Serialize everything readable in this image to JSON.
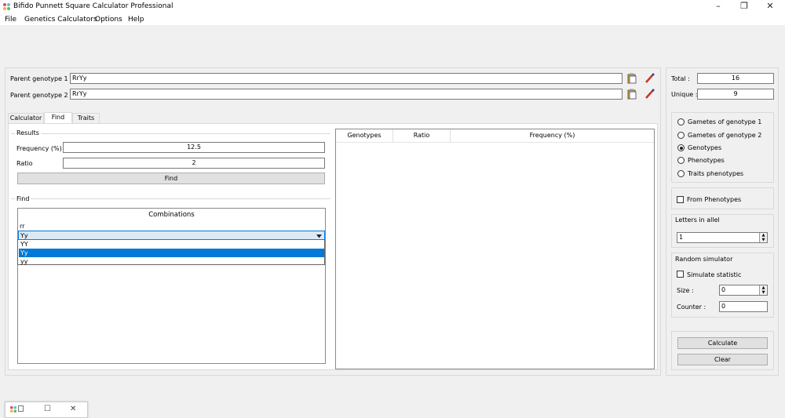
{
  "window": {
    "title": "Bifido Punnett Square Calculator Professional",
    "minimize": "–",
    "restore": "❐",
    "close": "✕"
  },
  "menu": [
    "File",
    "Genetics Calculators",
    "Options",
    "Help"
  ],
  "parents": {
    "p1_label": "Parent genotype 1 :",
    "p1_value": "RrYy",
    "p2_label": "Parent genotype 2 :",
    "p2_value": "RrYy"
  },
  "stats": {
    "total_label": "Total :",
    "total_value": "16",
    "unique_label": "Unique :",
    "unique_value": "9"
  },
  "tabs": [
    "Calculator",
    "Find",
    "Traits"
  ],
  "results": {
    "group": "Results",
    "freq_label": "Frequency (%)",
    "freq_value": "12.5",
    "ratio_label": "Ratio",
    "ratio_value": "2",
    "find_button": "Find"
  },
  "find": {
    "group": "Find",
    "combinations_header": "Combinations",
    "row1": "rr",
    "selected": "Yy",
    "options": [
      "YY",
      "Yy",
      "yy"
    ]
  },
  "table": {
    "columns": [
      "Genotypes",
      "Ratio",
      "Frequency (%)"
    ]
  },
  "options": {
    "radios": [
      "Gametes of genotype 1",
      "Gametes of genotype 2",
      "Genotypes",
      "Phenotypes",
      "Traits phenotypes"
    ],
    "from_phenotypes": "From Phenotypes",
    "letters_group": "Letters in allel",
    "letters_value": "1",
    "random_group": "Random simulator",
    "simulate_label": "Simulate statistic",
    "size_label": "Size :",
    "size_value": "0",
    "counter_label": "Counter :",
    "counter_value": "0"
  },
  "actions": {
    "calculate": "Calculate",
    "clear": "Clear"
  },
  "taskbar": {
    "restore": "☐",
    "close": "✕"
  },
  "colors": {
    "selection": "#0078d7",
    "accent_red": "#c0392b"
  }
}
